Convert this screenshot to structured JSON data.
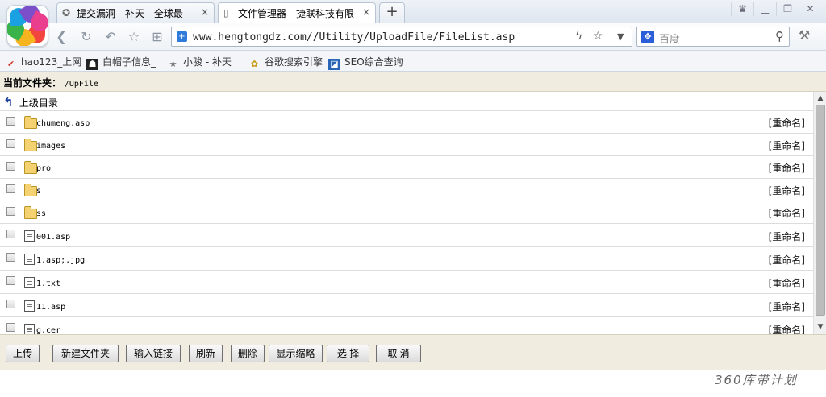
{
  "browser": {
    "tabs": [
      {
        "title": "提交漏洞 - 补天 - 全球最",
        "active": false
      },
      {
        "title": "文件管理器 - 捷联科技有限",
        "active": true
      }
    ],
    "tab_close_glyph": "×",
    "new_tab_glyph": "+",
    "url": "www.hengtongdz.com//Utility/UploadFile/FileList.asp",
    "search_placeholder": "百度",
    "bookmarks": [
      {
        "label": "hao123_上网",
        "icon": "hao123-icon"
      },
      {
        "label": "白帽子信息_",
        "icon": "whitehat-icon"
      },
      {
        "label": "小骏 - 补天",
        "icon": "star-icon"
      },
      {
        "label": "谷歌搜索引擎",
        "icon": "google-icon"
      },
      {
        "label": "SEO综合查询",
        "icon": "seo-icon"
      }
    ]
  },
  "page": {
    "current_dir_label": "当前文件夹：",
    "current_dir_path": "/UpFile",
    "parent_dir_label": "上级目录",
    "rename_label": "[重命名]",
    "items": [
      {
        "name": "chumeng.asp",
        "type": "folder"
      },
      {
        "name": "images",
        "type": "folder"
      },
      {
        "name": "pro",
        "type": "folder"
      },
      {
        "name": "s",
        "type": "folder"
      },
      {
        "name": "ss",
        "type": "folder"
      },
      {
        "name": "001.asp",
        "type": "file"
      },
      {
        "name": "1.asp;.jpg",
        "type": "file"
      },
      {
        "name": "1.txt",
        "type": "file"
      },
      {
        "name": "11.asp",
        "type": "file"
      },
      {
        "name": "g.cer",
        "type": "file"
      }
    ],
    "buttons": {
      "upload": "上传",
      "new_folder": "新建文件夹",
      "input_link": "输入链接",
      "refresh": "刷新",
      "delete": "删除",
      "show_thumbs": "显示缩略",
      "select": "选 择",
      "cancel": "取 消"
    }
  },
  "watermark": "360库带计划"
}
